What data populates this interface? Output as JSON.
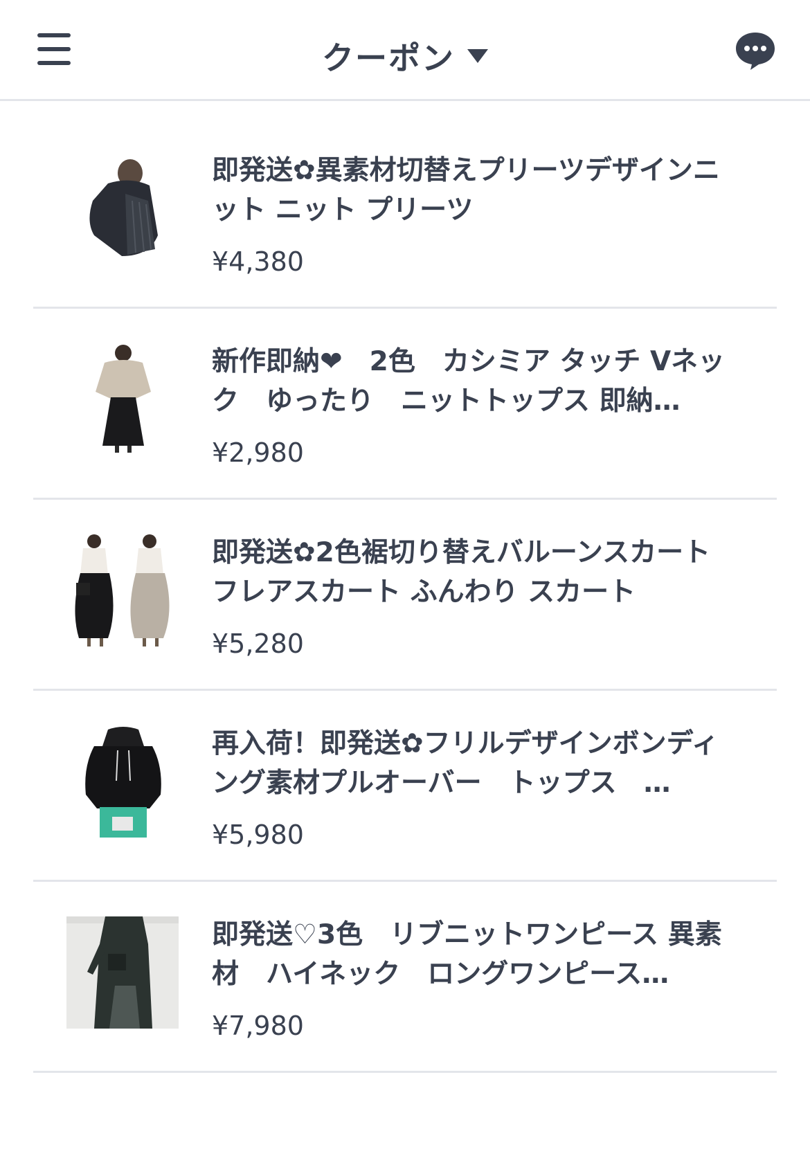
{
  "header": {
    "title": "クーポン",
    "menu_icon": "hamburger-menu-icon",
    "caret_icon": "caret-down-icon",
    "chat_icon": "chat-bubble-icon"
  },
  "products": [
    {
      "title": "即発送✿異素材切替えプリーツデザインニット ニット プリーツ",
      "price": "¥4,380",
      "thumbnail": "black-pleated-knit-image"
    },
    {
      "title": "新作即納❤　2色　カシミア タッチ Vネック　ゆったり　ニットトップス 即納…",
      "price": "¥2,980",
      "thumbnail": "beige-knit-black-skirt-image"
    },
    {
      "title": "即発送✿2色裾切り替えバルーンスカート フレアスカート ふんわり スカート",
      "price": "¥5,280",
      "thumbnail": "two-balloon-skirts-image"
    },
    {
      "title": "再入荷！即発送✿フリルデザインボンディング素材プルオーバー　トップス　…",
      "price": "¥5,980",
      "thumbnail": "black-hoodie-pullover-image"
    },
    {
      "title": "即発送♡3色　リブニットワンピース 異素材　ハイネック　ロングワンピース…",
      "price": "¥7,980",
      "thumbnail": "dark-long-dress-image"
    }
  ],
  "colors": {
    "text": "#3a4150",
    "divider": "#e3e5ea",
    "background": "#ffffff"
  }
}
